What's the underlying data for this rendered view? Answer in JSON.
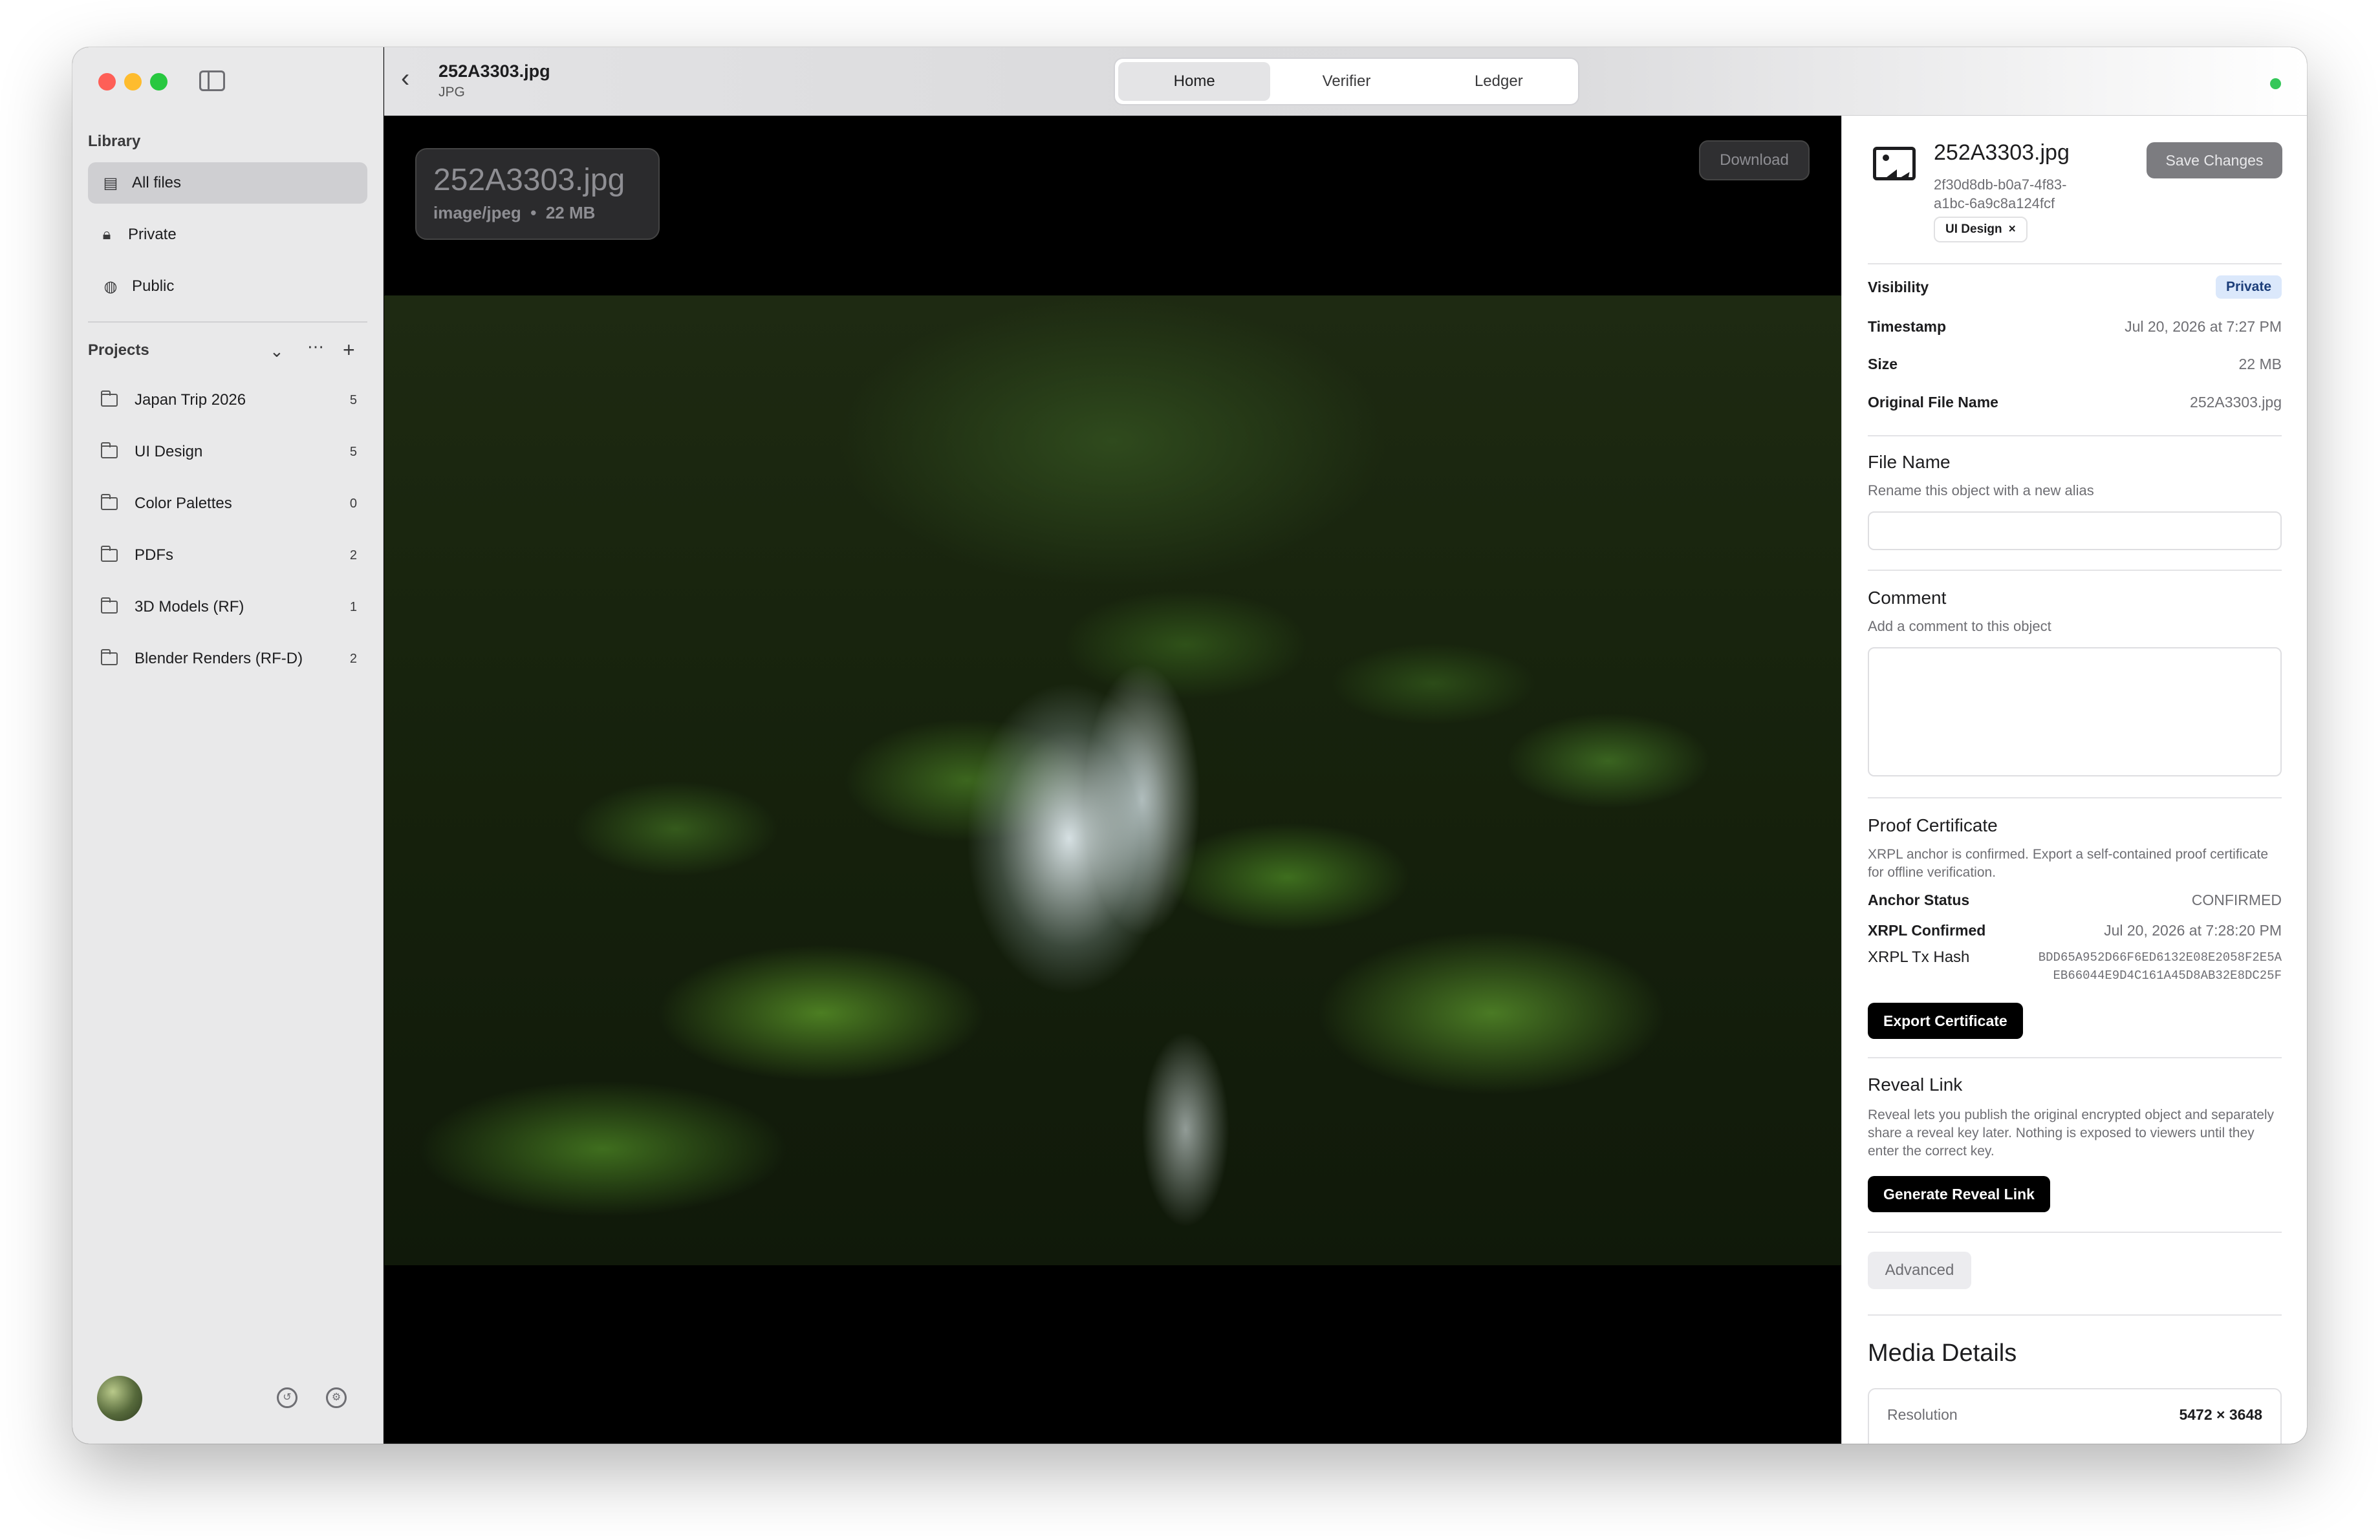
{
  "sidebar": {
    "library_title": "Library",
    "library_items": [
      {
        "label": "All files",
        "icon": "files-icon"
      },
      {
        "label": "Private",
        "icon": "lock-icon"
      },
      {
        "label": "Public",
        "icon": "globe-icon"
      }
    ],
    "projects_title": "Projects",
    "projects": [
      {
        "name": "Japan Trip 2026",
        "count": "5"
      },
      {
        "name": "UI Design",
        "count": "5"
      },
      {
        "name": "Color Palettes",
        "count": "0"
      },
      {
        "name": "PDFs",
        "count": "2"
      },
      {
        "name": "3D Models (RF)",
        "count": "1"
      },
      {
        "name": "Blender Renders (RF-D)",
        "count": "2"
      }
    ]
  },
  "topbar": {
    "file_name": "252A3303.jpg",
    "file_type": "JPG",
    "tabs": [
      "Home",
      "Verifier",
      "Ledger"
    ],
    "active_tab": "Home"
  },
  "viewer": {
    "title": "252A3303.jpg",
    "mime": "image/jpeg",
    "size": "22 MB",
    "separator": "•",
    "download_label": "Download"
  },
  "details": {
    "name": "252A3303.jpg",
    "uuid_line1": "2f30d8db-b0a7-4f83-",
    "uuid_line2": "a1bc-6a9c8a124fcf",
    "tag": "UI Design",
    "tag_remove": "×",
    "save_label": "Save Changes",
    "visibility_label": "Visibility",
    "visibility_value": "Private",
    "timestamp_label": "Timestamp",
    "timestamp_value": "Jul 20, 2026 at 7:27 PM",
    "size_label": "Size",
    "size_value": "22 MB",
    "orig_label": "Original File Name",
    "orig_value": "252A3303.jpg",
    "filename_title": "File Name",
    "filename_sub": "Rename this object with a new alias",
    "comment_title": "Comment",
    "comment_sub": "Add a comment to this object",
    "proof_title": "Proof Certificate",
    "proof_sub": "XRPL anchor is confirmed. Export a self-contained proof certificate for offline verification.",
    "anchor_label": "Anchor Status",
    "anchor_value": "CONFIRMED",
    "xrpl_confirmed_label": "XRPL Confirmed",
    "xrpl_confirmed_value": "Jul 20, 2026 at 7:28:20 PM",
    "tx_label": "XRPL Tx Hash",
    "tx_line1": "BDD65A952D66F6ED6132E08E2058F2E5A",
    "tx_line2": "EB66044E9D4C161A45D8AB32E8DC25F",
    "export_label": "Export Certificate",
    "reveal_title": "Reveal Link",
    "reveal_sub": "Reveal lets you publish the original encrypted object and separately share a reveal key later. Nothing is exposed to viewers until they enter the correct key.",
    "reveal_btn": "Generate Reveal Link",
    "advanced_label": "Advanced",
    "media_title": "Media Details",
    "resolution_label": "Resolution",
    "resolution_value": "5472 × 3648"
  },
  "colors": {
    "traffic_red": "#fe5f57",
    "traffic_yellow": "#febc2e",
    "traffic_green": "#28c840",
    "status_green": "#34c759",
    "private_pill_bg": "#dbe8fb"
  }
}
